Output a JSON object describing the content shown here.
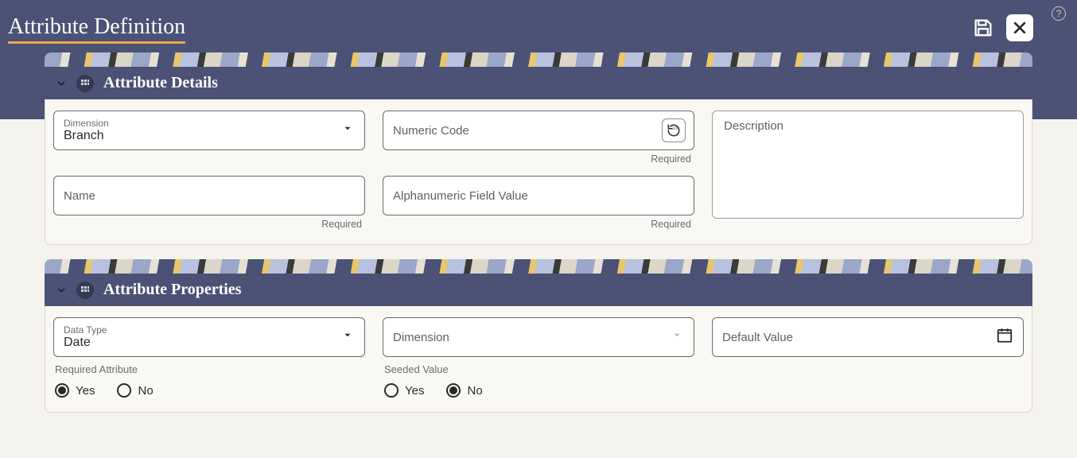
{
  "page": {
    "title": "Attribute Definition"
  },
  "actions": {
    "save": "Save",
    "close": "Close",
    "help": "?"
  },
  "sections": {
    "details": {
      "title": "Attribute Details",
      "dimension": {
        "label": "Dimension",
        "value": "Branch"
      },
      "numeric_code": {
        "placeholder": "Numeric Code",
        "helper": "Required"
      },
      "description": {
        "placeholder": "Description"
      },
      "name": {
        "placeholder": "Name",
        "helper": "Required"
      },
      "alpha_field": {
        "placeholder": "Alphanumeric Field Value",
        "helper": "Required"
      }
    },
    "properties": {
      "title": "Attribute Properties",
      "data_type": {
        "label": "Data Type",
        "value": "Date"
      },
      "dimension": {
        "placeholder": "Dimension"
      },
      "default_value": {
        "placeholder": "Default Value"
      },
      "required_attr": {
        "label": "Required Attribute",
        "options": {
          "yes": "Yes",
          "no": "No"
        },
        "selected": "yes"
      },
      "seeded_value": {
        "label": "Seeded Value",
        "options": {
          "yes": "Yes",
          "no": "No"
        },
        "selected": "no"
      }
    }
  }
}
